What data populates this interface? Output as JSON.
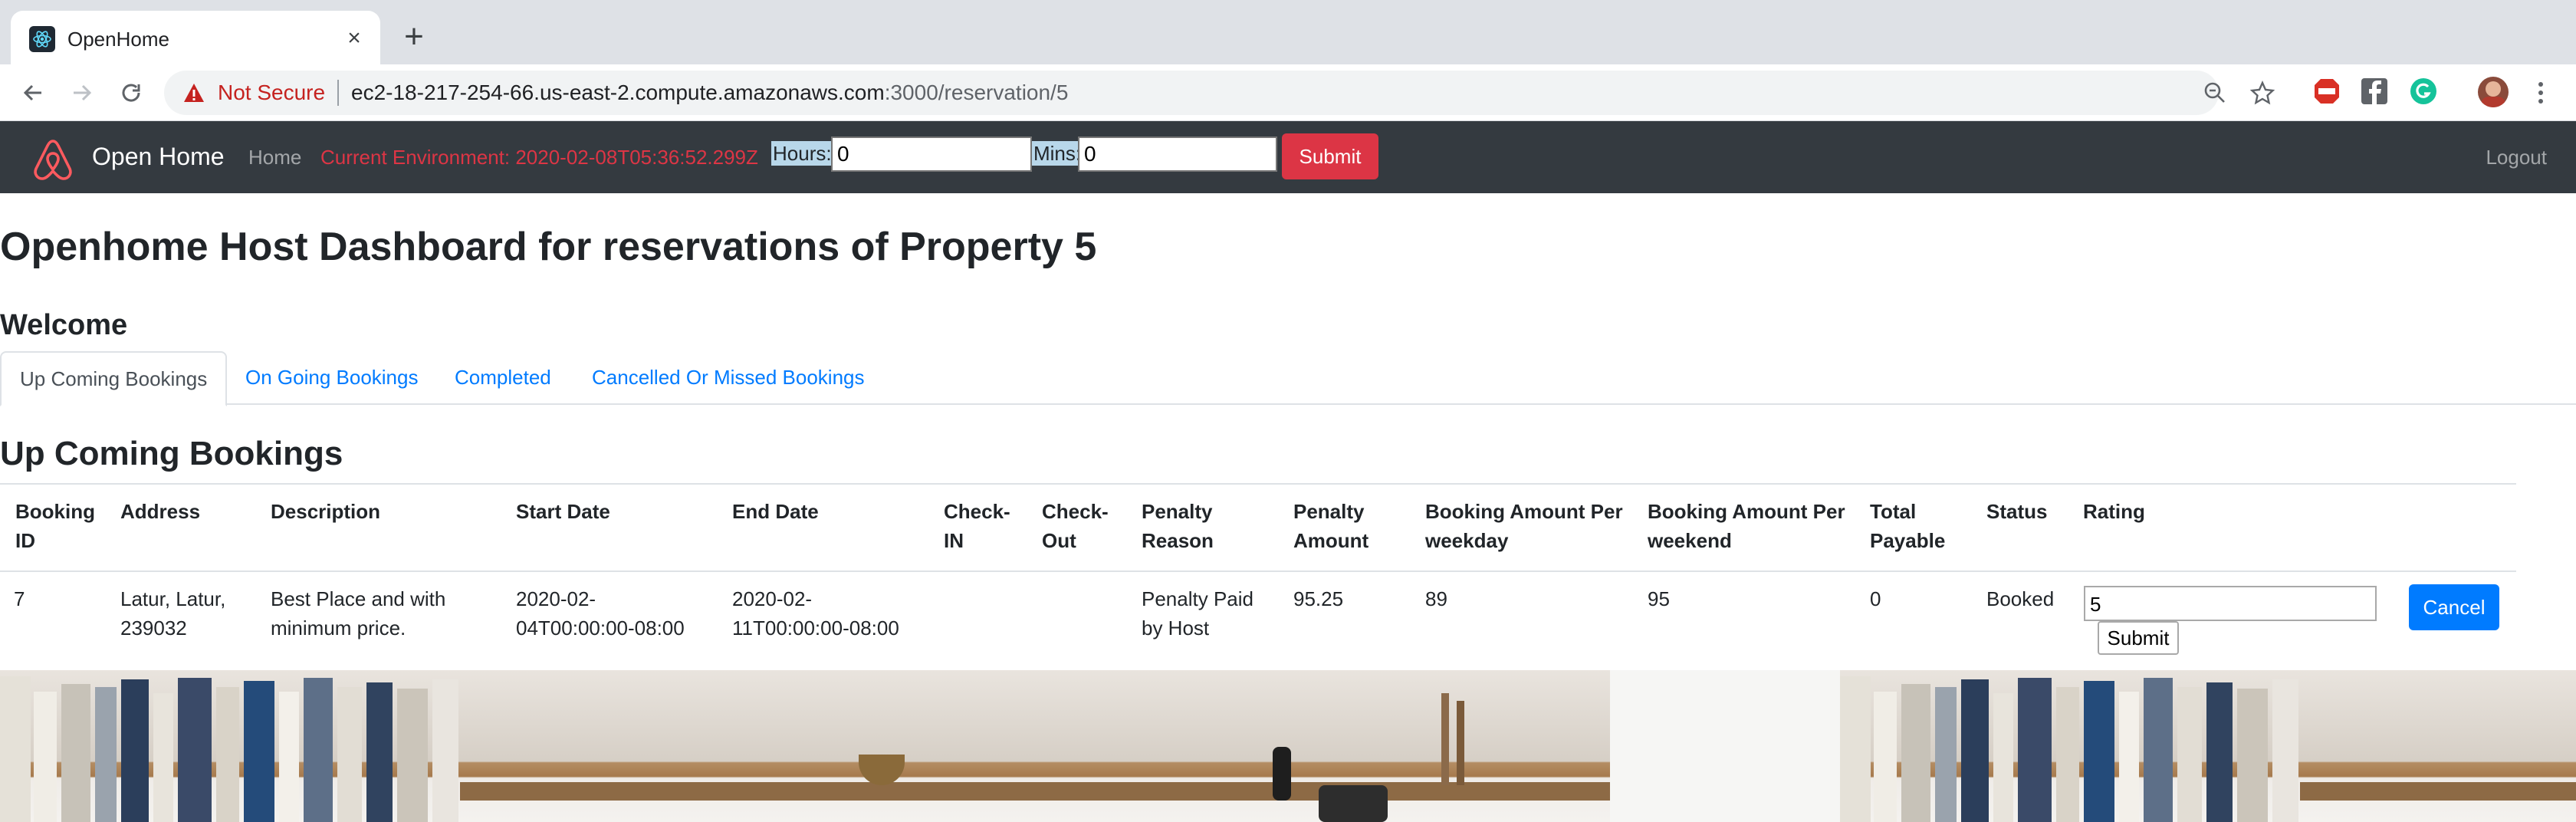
{
  "browser": {
    "tab_title": "OpenHome",
    "tab_close": "×",
    "new_tab": "+",
    "security_label": "Not Secure",
    "url_host": "ec2-18-217-254-66.us-east-2.compute.amazonaws.com",
    "url_rest": ":3000/reservation/5"
  },
  "navbar": {
    "brand": "Open Home",
    "home": "Home",
    "environment": "Current Environment: 2020-02-08T05:36:52.299Z",
    "hours_label": "Hours:",
    "hours_value": "0",
    "mins_label": "Mins:",
    "mins_value": "0",
    "submit": "Submit",
    "logout": "Logout",
    "bg_color": "#343a40",
    "submit_color": "#dc3545"
  },
  "page": {
    "title": "Openhome Host Dashboard for reservations of Property 5",
    "welcome": "Welcome",
    "tabs": [
      {
        "label": "Up Coming Bookings",
        "active": true
      },
      {
        "label": "On Going Bookings",
        "active": false
      },
      {
        "label": "Completed",
        "active": false
      },
      {
        "label": "Cancelled Or Missed Bookings",
        "active": false
      }
    ],
    "section_title": "Up Coming Bookings"
  },
  "table": {
    "headers": [
      [
        "Booking",
        "ID"
      ],
      [
        "Address",
        ""
      ],
      [
        "Description",
        ""
      ],
      [
        "Start Date",
        ""
      ],
      [
        "End Date",
        ""
      ],
      [
        "Check-",
        "IN"
      ],
      [
        "Check-",
        "Out"
      ],
      [
        "Penalty",
        "Reason"
      ],
      [
        "Penalty",
        "Amount"
      ],
      [
        "Booking Amount Per",
        "weekday"
      ],
      [
        "Booking Amount Per",
        "weekend"
      ],
      [
        "Total",
        "Payable"
      ],
      [
        "Status",
        ""
      ],
      [
        "Rating",
        ""
      ]
    ],
    "rows": [
      {
        "booking_id": "7",
        "address": [
          "Latur, Latur,",
          "239032"
        ],
        "description": [
          "Best Place and with",
          "minimum price."
        ],
        "start_date": [
          "2020-02-",
          "04T00:00:00-08:00"
        ],
        "end_date": [
          "2020-02-",
          "11T00:00:00-08:00"
        ],
        "check_in": "",
        "check_out": "",
        "penalty_reason": [
          "Penalty Paid",
          "by Host"
        ],
        "penalty_amount": "95.25",
        "weekday_amount": "89",
        "weekend_amount": "95",
        "total_payable": "0",
        "status": "Booked",
        "rating_value": "5",
        "rating_submit": "Submit",
        "cancel": "Cancel"
      }
    ],
    "accent_color": "#007bff"
  }
}
